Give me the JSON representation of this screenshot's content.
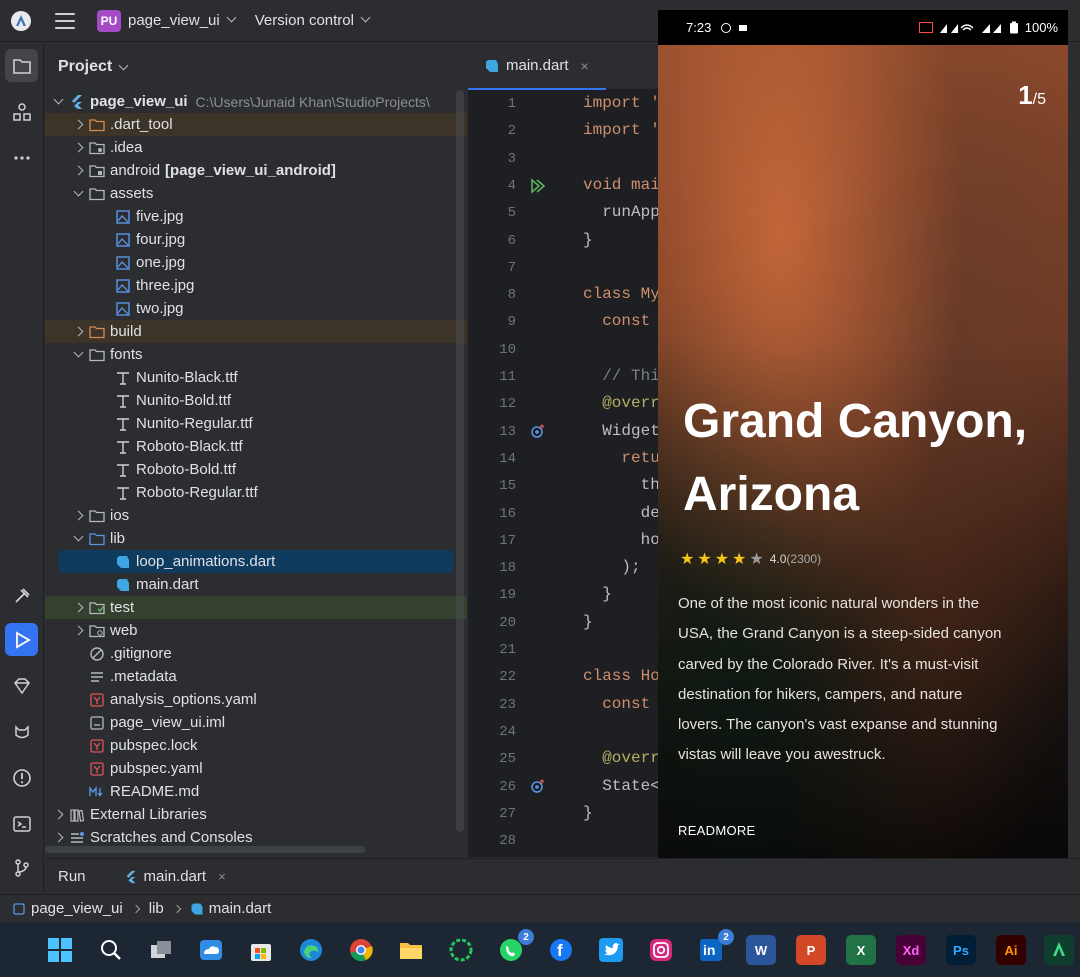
{
  "topbar": {
    "project_badge": "PU",
    "project_name": "page_view_ui",
    "vcs_label": "Version control"
  },
  "project_panel": {
    "title": "Project",
    "root_name": "page_view_ui",
    "root_path": "C:\\Users\\Junaid Khan\\StudioProjects\\",
    "items": [
      {
        "label": ".dart_tool"
      },
      {
        "label": ".idea"
      },
      {
        "label": "android",
        "suffix": "[page_view_ui_android]"
      },
      {
        "label": "assets"
      },
      {
        "label": "five.jpg"
      },
      {
        "label": "four.jpg"
      },
      {
        "label": "one.jpg"
      },
      {
        "label": "three.jpg"
      },
      {
        "label": "two.jpg"
      },
      {
        "label": "build"
      },
      {
        "label": "fonts"
      },
      {
        "label": "Nunito-Black.ttf"
      },
      {
        "label": "Nunito-Bold.ttf"
      },
      {
        "label": "Nunito-Regular.ttf"
      },
      {
        "label": "Roboto-Black.ttf"
      },
      {
        "label": "Roboto-Bold.ttf"
      },
      {
        "label": "Roboto-Regular.ttf"
      },
      {
        "label": "ios"
      },
      {
        "label": "lib"
      },
      {
        "label": "loop_animations.dart"
      },
      {
        "label": "main.dart"
      },
      {
        "label": "test"
      },
      {
        "label": "web"
      },
      {
        "label": ".gitignore"
      },
      {
        "label": ".metadata"
      },
      {
        "label": "analysis_options.yaml"
      },
      {
        "label": "page_view_ui.iml"
      },
      {
        "label": "pubspec.lock"
      },
      {
        "label": "pubspec.yaml"
      },
      {
        "label": "README.md"
      },
      {
        "label": "External Libraries"
      },
      {
        "label": "Scratches and Consoles"
      }
    ]
  },
  "editor": {
    "tab_label": "main.dart",
    "tab_close": "×",
    "line_numbers": [
      "1",
      "2",
      "3",
      "4",
      "5",
      "6",
      "7",
      "8",
      "9",
      "10",
      "11",
      "12",
      "13",
      "14",
      "15",
      "16",
      "17",
      "18",
      "19",
      "20",
      "21",
      "22",
      "23",
      "24",
      "25",
      "26",
      "27",
      "28"
    ],
    "code_lines": [
      {
        "text": "import '",
        "cls": "kw"
      },
      {
        "text": "import '",
        "cls": "kw"
      },
      {
        "text": "",
        "cls": ""
      },
      {
        "text": "void mai",
        "cls": "kw"
      },
      {
        "text": "  runApp",
        "cls": ""
      },
      {
        "text": "}",
        "cls": ""
      },
      {
        "text": "",
        "cls": ""
      },
      {
        "text": "class My",
        "cls": "kw"
      },
      {
        "text": "  const",
        "cls": "kw"
      },
      {
        "text": "",
        "cls": ""
      },
      {
        "text": "  // Thi",
        "cls": "cm"
      },
      {
        "text": "  @overr",
        "cls": "ann"
      },
      {
        "text": "  Widget",
        "cls": ""
      },
      {
        "text": "    retu",
        "cls": "kw"
      },
      {
        "text": "      th",
        "cls": ""
      },
      {
        "text": "      de",
        "cls": ""
      },
      {
        "text": "      ho",
        "cls": ""
      },
      {
        "text": "    );",
        "cls": ""
      },
      {
        "text": "  }",
        "cls": ""
      },
      {
        "text": "}",
        "cls": ""
      },
      {
        "text": "",
        "cls": ""
      },
      {
        "text": "class Ho",
        "cls": "kw"
      },
      {
        "text": "  const",
        "cls": "kw"
      },
      {
        "text": "",
        "cls": ""
      },
      {
        "text": "  @overr",
        "cls": "ann"
      },
      {
        "text": "  State<",
        "cls": ""
      },
      {
        "text": "}",
        "cls": ""
      },
      {
        "text": "",
        "cls": ""
      }
    ]
  },
  "phone": {
    "time": "7:23",
    "battery": "100%",
    "page_current": "1",
    "page_total": "/5",
    "title": "Grand Canyon, Arizona",
    "rating": "4.0",
    "rating_count": "(2300)",
    "description": "One of the most iconic natural wonders in the USA, the Grand Canyon is a steep-sided canyon carved by the Colorado River. It's a must-visit destination for hikers, campers, and nature lovers. The canyon's vast expanse and stunning vistas will leave you awestruck.",
    "readmore": "READMORE",
    "stars_filled": 4,
    "stars_total": 5
  },
  "runbar": {
    "run_label": "Run",
    "tab_label": "main.dart",
    "tab_close": "×"
  },
  "breadcrumb": {
    "items": [
      "page_view_ui",
      "lib",
      "main.dart"
    ]
  },
  "taskbar": {
    "whatsapp_badge": "2",
    "linkedin_badge": "2",
    "word_label": "W",
    "ppt_label": "P",
    "excel_label": "X",
    "xd_label": "Xd",
    "ps_label": "Ps",
    "ai_label": "Ai",
    "linkedin_label": "in",
    "facebook_label": "f"
  },
  "colors": {
    "accent": "#3574f0",
    "ide_bg": "#2b2d30",
    "editor_bg": "#1e1f22",
    "keyword": "#cf8e6d",
    "star": "#f5c518",
    "project_badge": "#a54bc6"
  }
}
